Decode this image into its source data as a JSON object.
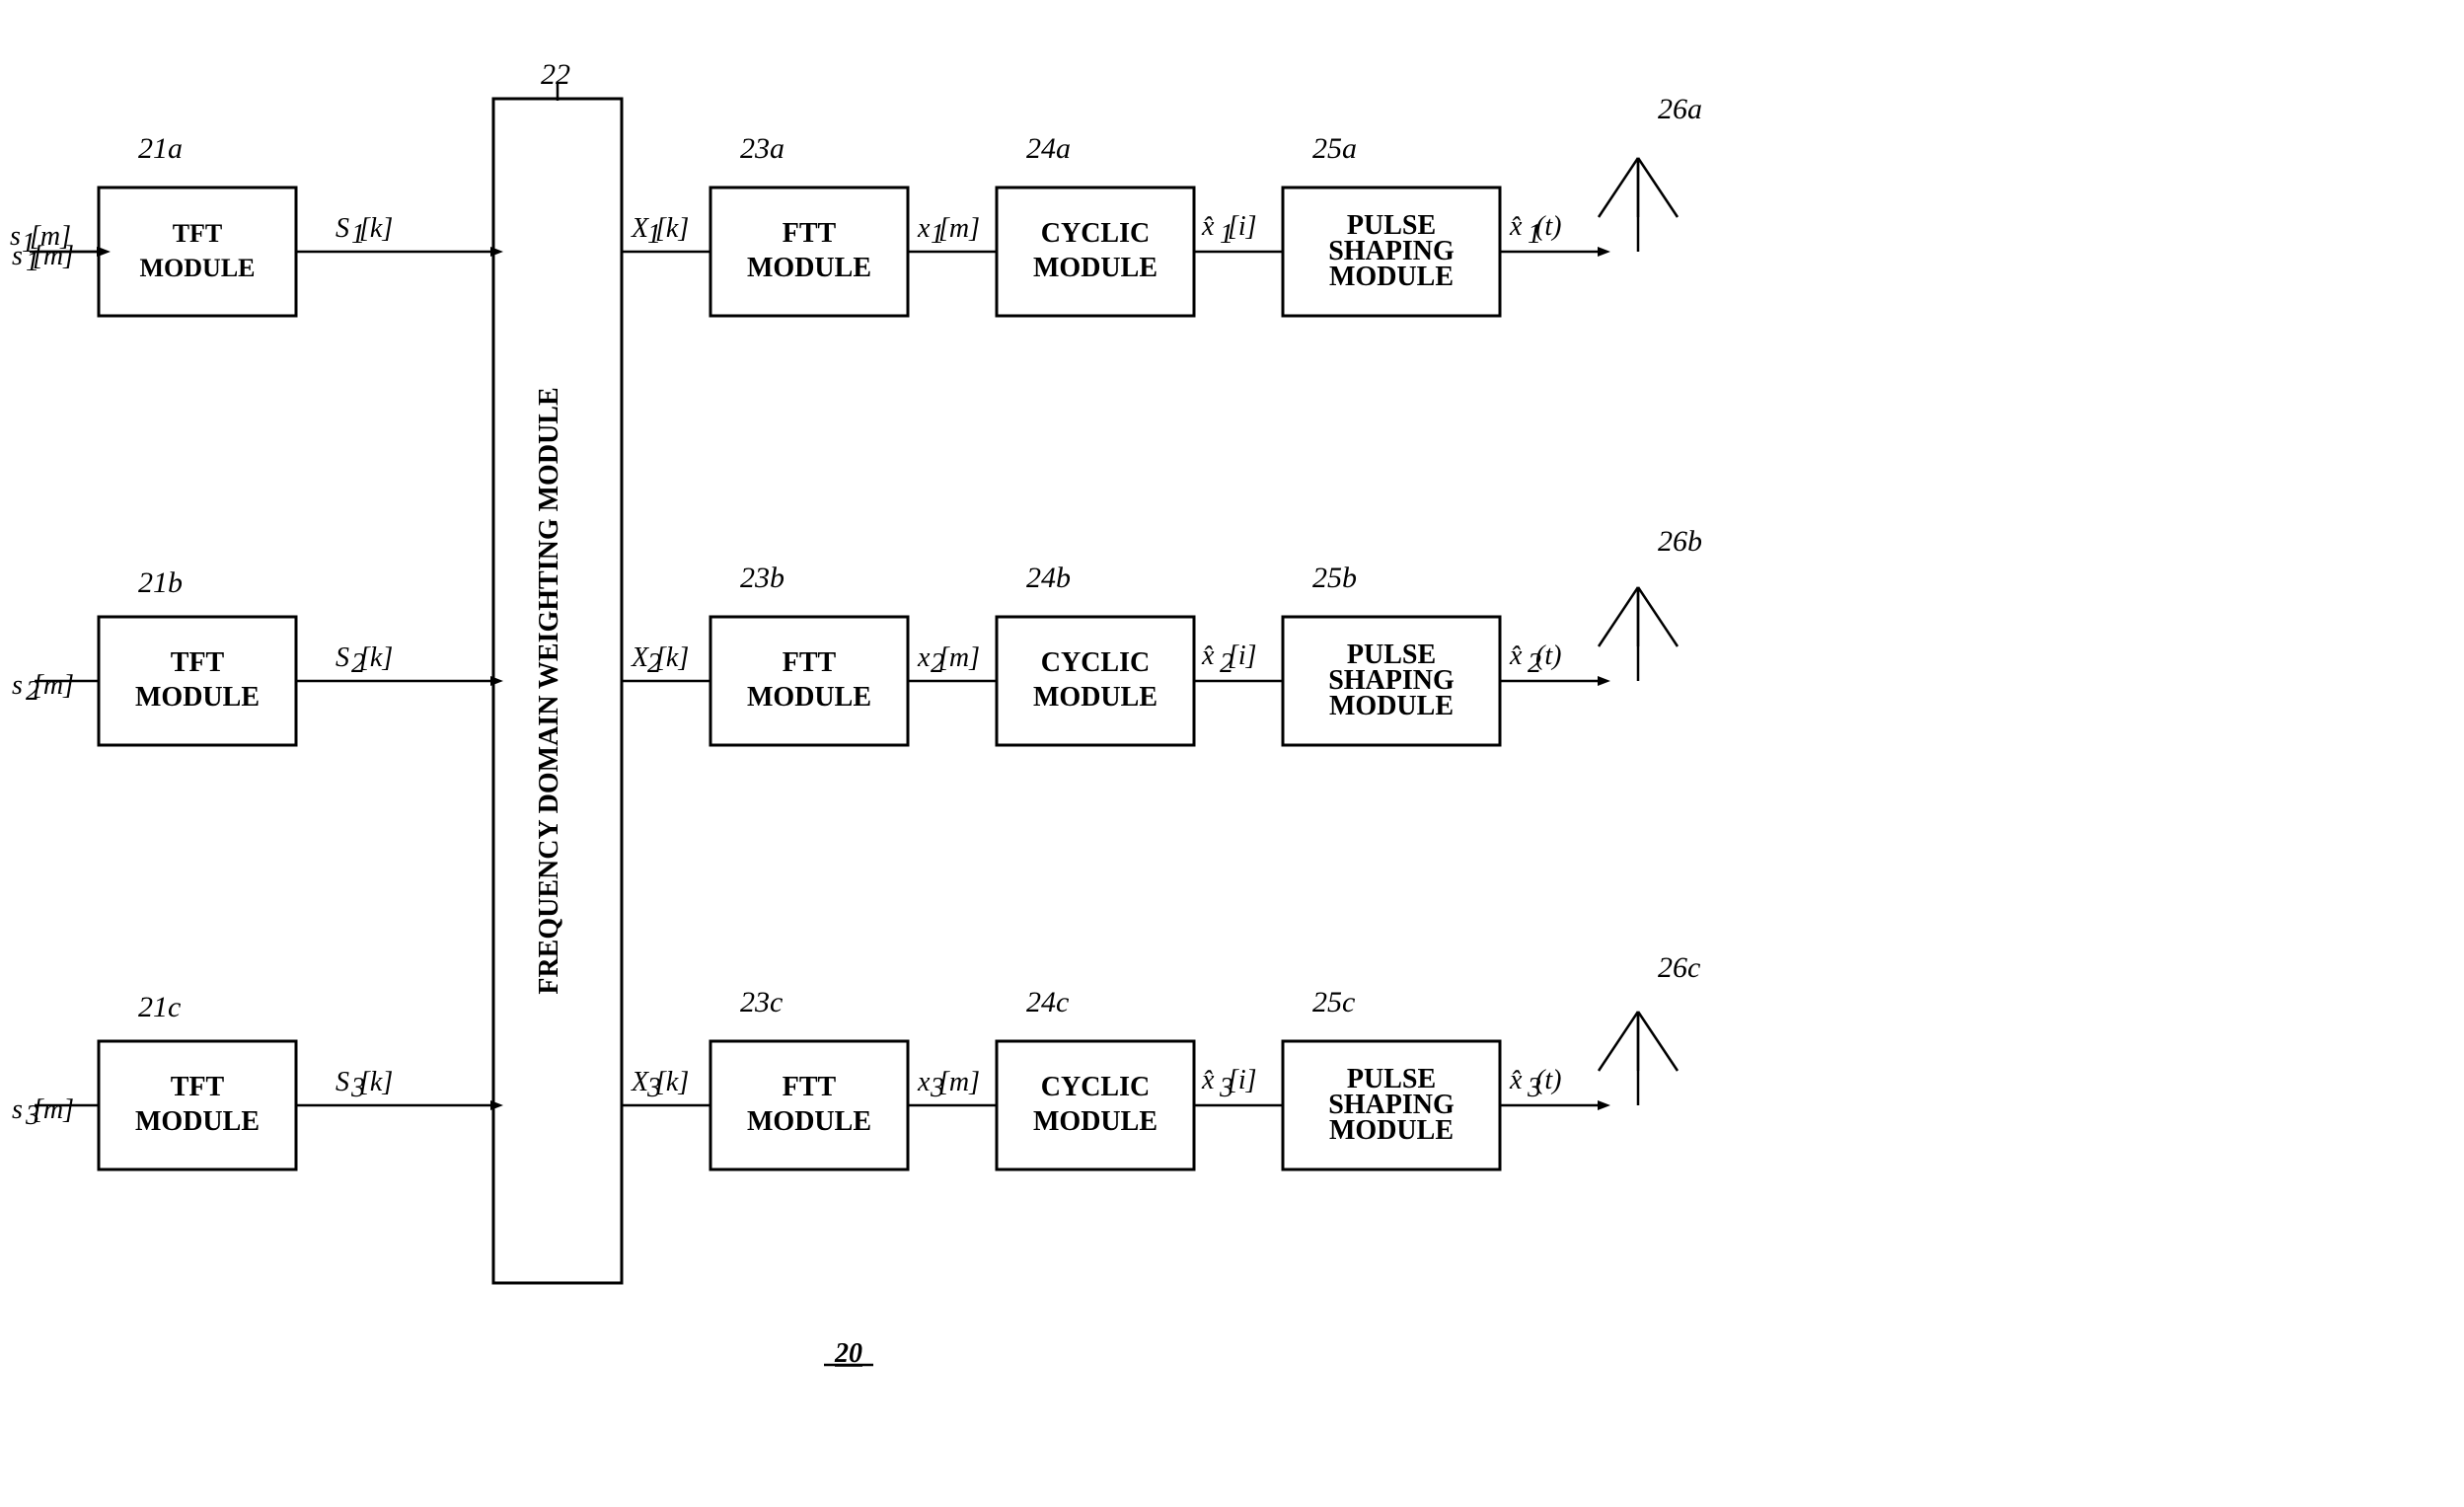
{
  "diagram": {
    "title": "20",
    "rows": [
      {
        "id": "row_a",
        "input_signal": "s₁[m]",
        "input_ref": "21a",
        "tft_label": [
          "TFT",
          "MODULE"
        ],
        "s_signal": "S₁[k]",
        "x_cap_signal": "X₁[k]",
        "ftt_ref": "23a",
        "ftt_label": [
          "FTT",
          "MODULE"
        ],
        "x_signal": "x₁[m]",
        "cyclic_ref": "24a",
        "cyclic_label": [
          "CYCLIC",
          "MODULE"
        ],
        "xhat_signal": "x̂₁[i]",
        "pulse_ref": "25a",
        "pulse_label": [
          "PULSE",
          "SHAPING",
          "MODULE"
        ],
        "output_signal": "x̂₁(t)",
        "antenna_ref": "26a"
      },
      {
        "id": "row_b",
        "input_signal": "s₂[m]",
        "input_ref": "21b",
        "tft_label": [
          "TFT",
          "MODULE"
        ],
        "s_signal": "S₂[k]",
        "x_cap_signal": "X₂[k]",
        "ftt_ref": "23b",
        "ftt_label": [
          "FTT",
          "MODULE"
        ],
        "x_signal": "x₂[m]",
        "cyclic_ref": "24b",
        "cyclic_label": [
          "CYCLIC",
          "MODULE"
        ],
        "xhat_signal": "x̂₂[i]",
        "pulse_ref": "25b",
        "pulse_label": [
          "PULSE",
          "SHAPING",
          "MODULE"
        ],
        "output_signal": "x̂₂(t)",
        "antenna_ref": "26b"
      },
      {
        "id": "row_c",
        "input_signal": "s₃[m]",
        "input_ref": "21c",
        "tft_label": [
          "TFT",
          "MODULE"
        ],
        "s_signal": "S₃[k]",
        "x_cap_signal": "X₃[k]",
        "ftt_ref": "23c",
        "ftt_label": [
          "FTT",
          "MODULE"
        ],
        "x_signal": "x₃[m]",
        "cyclic_ref": "24c",
        "cyclic_label": [
          "CYCLIC",
          "MODULE"
        ],
        "xhat_signal": "x̂₃[i]",
        "pulse_ref": "25c",
        "pulse_label": [
          "PULSE",
          "SHAPING",
          "MODULE"
        ],
        "output_signal": "x̂₃(t)",
        "antenna_ref": "26c"
      }
    ],
    "freq_domain_ref": "22",
    "freq_domain_label": [
      "FREQUENCY",
      "DOMAIN",
      "WEIGHTING",
      "MODULE"
    ]
  }
}
